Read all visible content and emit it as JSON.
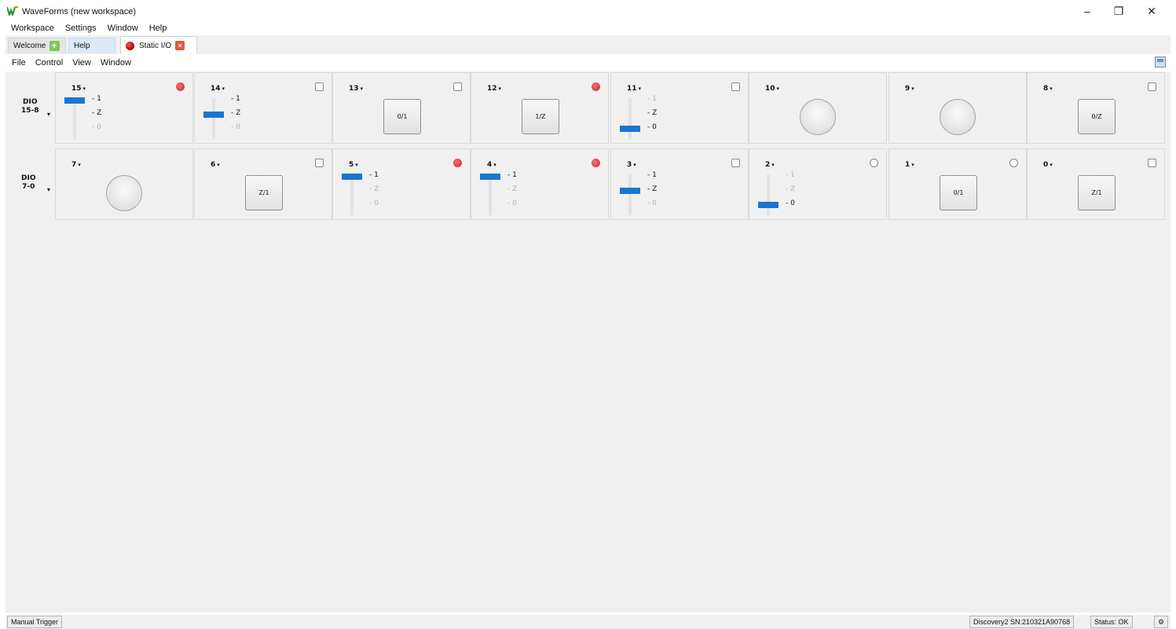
{
  "window": {
    "title": "WaveForms  (new workspace)",
    "minimize_glyph": "–",
    "maximize_glyph": "❐",
    "close_glyph": "✕"
  },
  "main_menu": [
    "Workspace",
    "Settings",
    "Window",
    "Help"
  ],
  "tabs": {
    "welcome": "Welcome",
    "help": "Help",
    "static_io": "Static I/O",
    "add_glyph": "+",
    "close_glyph": "×"
  },
  "tool_menu": [
    "File",
    "Control",
    "View",
    "Window"
  ],
  "groups": [
    {
      "line1": "DIO",
      "line2": "15-8",
      "arrow": "▾"
    },
    {
      "line1": "DIO",
      "line2": "7-0",
      "arrow": "▾"
    }
  ],
  "pins": [
    {
      "label": "15",
      "led": "red",
      "control": "slider",
      "value": "1"
    },
    {
      "label": "14",
      "led": "off-square",
      "control": "slider",
      "value": "Z"
    },
    {
      "label": "13",
      "led": "off-square",
      "control": "button",
      "text": "0/1"
    },
    {
      "label": "12",
      "led": "red",
      "control": "button",
      "text": "1/Z"
    },
    {
      "label": "11",
      "led": "off-square",
      "control": "slider",
      "value": "0"
    },
    {
      "label": "10",
      "led": "none",
      "control": "lamp"
    },
    {
      "label": "9",
      "led": "none",
      "control": "lamp"
    },
    {
      "label": "8",
      "led": "off-square",
      "control": "button",
      "text": "0/Z"
    },
    {
      "label": "7",
      "led": "none",
      "control": "lamp"
    },
    {
      "label": "6",
      "led": "off-square",
      "control": "button",
      "text": "Z/1"
    },
    {
      "label": "5",
      "led": "red",
      "control": "slider",
      "value": "1"
    },
    {
      "label": "4",
      "led": "red",
      "control": "slider",
      "value": "1"
    },
    {
      "label": "3",
      "led": "off-square",
      "control": "slider",
      "value": "Z"
    },
    {
      "label": "2",
      "led": "off-circle",
      "control": "slider",
      "value": "0"
    },
    {
      "label": "1",
      "led": "off-circle",
      "control": "button",
      "text": "0/1"
    },
    {
      "label": "0",
      "led": "off-square",
      "control": "button",
      "text": "Z/1"
    }
  ],
  "slider_ticks": [
    "- 1",
    "- Z",
    "- 0"
  ],
  "pin_caret": "▾",
  "status_bar": {
    "trigger": "Manual Trigger",
    "device": "Discovery2 SN:210321A90768",
    "status": "Status: OK",
    "gear_glyph": "⚙"
  },
  "colors": {
    "accent": "#1a75d1",
    "led_on": "#d83a3a",
    "background": "#f0f0f0"
  }
}
